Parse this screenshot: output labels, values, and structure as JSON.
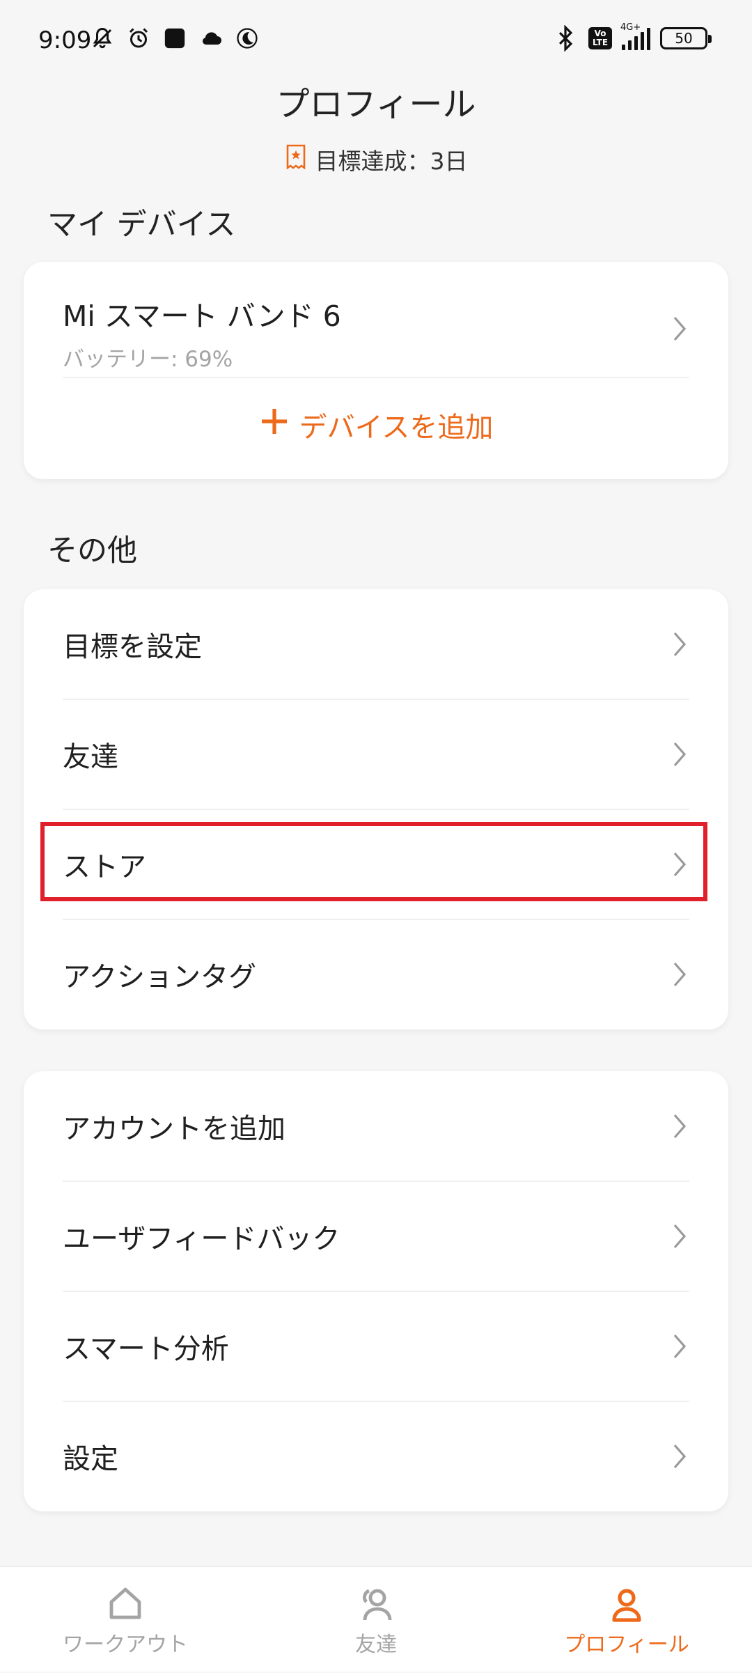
{
  "status_bar": {
    "time": "9:09",
    "network": "4G+",
    "volte_top": "Vo",
    "volte_bottom": "LTE",
    "battery": "50"
  },
  "header": {
    "title": "プロフィール",
    "goal_streak": "目標達成：3日"
  },
  "my_devices": {
    "section_title": "マイ デバイス",
    "device_name": "Mi スマート バンド 6",
    "device_battery": "バッテリー: 69%",
    "add_device_label": "デバイスを追加"
  },
  "other": {
    "section_title": "その他",
    "items": [
      {
        "label": "目標を設定"
      },
      {
        "label": "友達"
      },
      {
        "label": "ストア"
      },
      {
        "label": "アクションタグ"
      }
    ]
  },
  "account": {
    "items": [
      {
        "label": "アカウントを追加"
      },
      {
        "label": "ユーザフィードバック"
      },
      {
        "label": "スマート分析"
      },
      {
        "label": "設定"
      }
    ]
  },
  "tab_bar": {
    "tabs": [
      {
        "label": "ワークアウト",
        "icon": "home-icon"
      },
      {
        "label": "友達",
        "icon": "friends-icon"
      },
      {
        "label": "プロフィール",
        "icon": "profile-icon"
      }
    ],
    "active_index": 2
  },
  "colors": {
    "accent": "#ed6a1b",
    "highlight": "#e0202a",
    "inactive": "#a4a4a4"
  }
}
